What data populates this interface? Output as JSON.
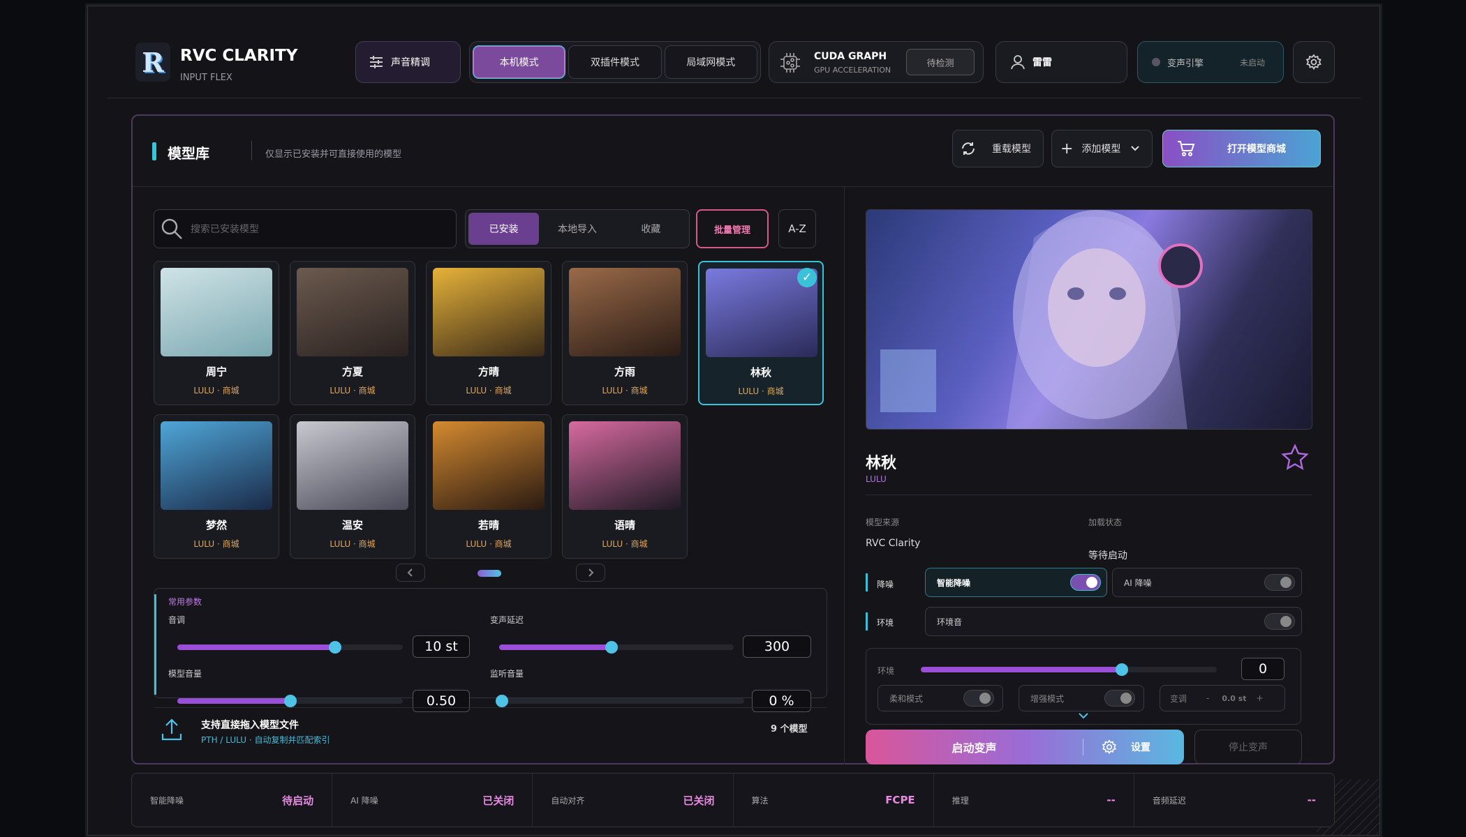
{
  "header": {
    "brand_logo": "R",
    "brand_title": "RVC CLARITY",
    "brand_subtitle": "INPUT FLEX",
    "tune_label": "声音精调",
    "modes": [
      "本机模式",
      "双插件模式",
      "局域网模式"
    ],
    "active_mode": "本机模式",
    "cuda_title": "CUDA GRAPH",
    "cuda_subtitle": "GPU ACCELERATION",
    "cuda_status": "待检测",
    "user_name": "雷雷",
    "engine_label": "变声引擎",
    "engine_status": "未启动"
  },
  "library": {
    "title": "模型库",
    "subtitle": "仅显示已安装并可直接使用的模型",
    "reload_label": "重载模型",
    "add_label": "添加模型",
    "shop_label": "打开模型商城",
    "search_placeholder": "搜索已安装模型",
    "tabs": [
      "已安装",
      "本地导入",
      "收藏"
    ],
    "batch_label": "批量管理",
    "sort_label": "A-Z",
    "models": [
      {
        "name": "周宁",
        "tag": "LULU · 商城",
        "c1": "#cfe3e6",
        "c2": "#7aa8b0"
      },
      {
        "name": "方夏",
        "tag": "LULU · 商城",
        "c1": "#6b5a4e",
        "c2": "#2a2220"
      },
      {
        "name": "方晴",
        "tag": "LULU · 商城",
        "c1": "#e6b23a",
        "c2": "#3a2a18"
      },
      {
        "name": "方雨",
        "tag": "LULU · 商城",
        "c1": "#9a6a48",
        "c2": "#2a1c16"
      },
      {
        "name": "林秋",
        "tag": "LULU · 商城",
        "c1": "#7a7ae0",
        "c2": "#2a2a58"
      },
      {
        "name": "梦然",
        "tag": "LULU · 商城",
        "c1": "#4fa6d8",
        "c2": "#1a2a48"
      },
      {
        "name": "温安",
        "tag": "LULU · 商城",
        "c1": "#c8c8d0",
        "c2": "#4a4a58"
      },
      {
        "name": "若晴",
        "tag": "LULU · 商城",
        "c1": "#d48a30",
        "c2": "#2a1a12"
      },
      {
        "name": "语晴",
        "tag": "LULU · 商城",
        "c1": "#d86aa0",
        "c2": "#1e1a24"
      }
    ],
    "model_count": "9 个模型",
    "drop_title": "支持直接拖入模型文件",
    "drop_sub": "PTH / LULU · 自动复制并匹配索引"
  },
  "params": {
    "section": "常用参数",
    "pitch_label": "音调",
    "pitch_value": "10 st",
    "pitch_frac": 0.7,
    "latency_label": "变声延迟",
    "latency_value": "300",
    "latency_frac": 0.48,
    "model_vol_label": "模型音量",
    "model_vol_value": "0.50",
    "model_vol_frac": 0.5,
    "monitor_label": "监听音量",
    "monitor_value": "0 %",
    "monitor_frac": 0.0
  },
  "detail": {
    "name": "林秋",
    "tag": "LULU",
    "source_key": "模型来源",
    "source_value": "RVC Clarity",
    "state_key": "加载状态",
    "state_value": "等待启动",
    "denoise_label": "降噪",
    "smart_denoise": "智能降噪",
    "ai_denoise": "AI 降噪",
    "env_label": "环境",
    "env_sound": "环境音",
    "env_slider_label": "环境",
    "env_value": "0",
    "env_frac": 0.68,
    "soft_mode": "柔和模式",
    "boost_mode": "增强模式",
    "pitch_short": "变调",
    "pitch_minus": "-",
    "pitch_small": "0.0 st",
    "pitch_plus": "+",
    "start_label": "启动变声",
    "settings_label": "设置",
    "stop_label": "停止变声"
  },
  "status": [
    {
      "k": "智能降噪",
      "v": "待启动"
    },
    {
      "k": "AI 降噪",
      "v": "已关闭"
    },
    {
      "k": "自动对齐",
      "v": "已关闭"
    },
    {
      "k": "算法",
      "v": "FCPE"
    },
    {
      "k": "推理",
      "v": "--"
    },
    {
      "k": "音频延迟",
      "v": "--"
    }
  ]
}
